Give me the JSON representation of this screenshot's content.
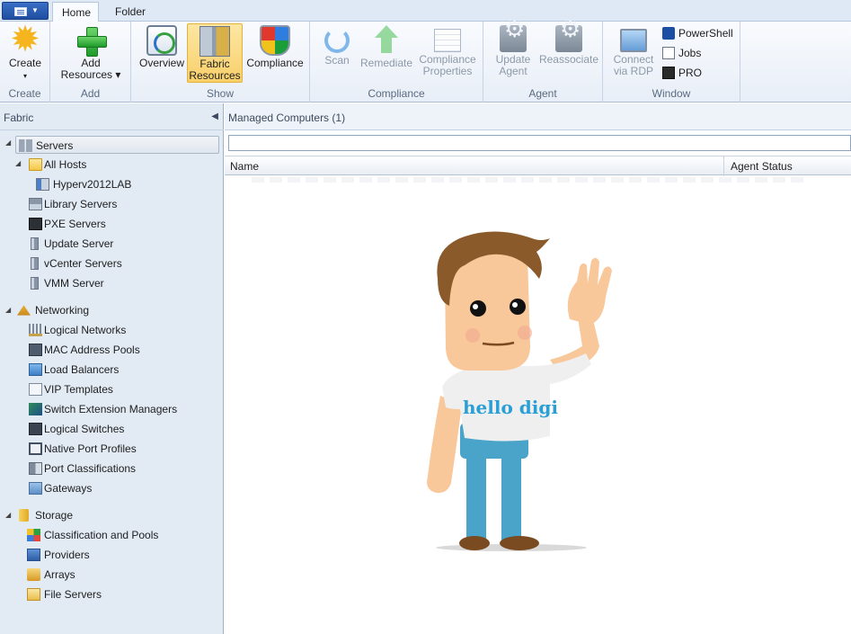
{
  "tabs": {
    "home": "Home",
    "folder": "Folder"
  },
  "ribbon": {
    "groups": [
      {
        "label": "Create"
      },
      {
        "label": "Add"
      },
      {
        "label": "Show"
      },
      {
        "label": "Compliance"
      },
      {
        "label": "Agent"
      },
      {
        "label": "Window"
      }
    ],
    "buttons": {
      "create_line1": "Create",
      "create_line2": "▾",
      "add_line1": "Add",
      "add_line2": "Resources ▾",
      "overview": "Overview",
      "fabric_line1": "Fabric",
      "fabric_line2": "Resources",
      "compliance": "Compliance",
      "scan": "Scan",
      "remediate": "Remediate",
      "compprops_line1": "Compliance",
      "compprops_line2": "Properties",
      "update_line1": "Update",
      "update_line2": "Agent",
      "reassociate": "Reassociate",
      "rdp_line1": "Connect",
      "rdp_line2": "via RDP",
      "powershell": "PowerShell",
      "jobs": "Jobs",
      "pro": "PRO"
    }
  },
  "nav": {
    "header": "Fabric",
    "servers": "Servers",
    "all_hosts": "All Hosts",
    "host": "Hyperv2012LAB",
    "library_servers": "Library Servers",
    "pxe_servers": "PXE Servers",
    "update_server": "Update Server",
    "vcenter_servers": "vCenter Servers",
    "vmm_server": "VMM Server",
    "networking": "Networking",
    "logical_networks": "Logical Networks",
    "mac_pools": "MAC Address Pools",
    "load_balancers": "Load Balancers",
    "vip_templates": "VIP Templates",
    "switch_ext": "Switch Extension Managers",
    "logical_switches": "Logical Switches",
    "native_port": "Native Port Profiles",
    "port_class": "Port Classifications",
    "gateways": "Gateways",
    "storage": "Storage",
    "class_pools": "Classification and Pools",
    "providers": "Providers",
    "arrays": "Arrays",
    "file_servers": "File Servers"
  },
  "content": {
    "title": "Managed Computers (1)",
    "search_value": "",
    "columns": {
      "name": "Name",
      "agent_status": "Agent Status"
    }
  },
  "overlay": {
    "shirt_text": "hello digi"
  },
  "colors": {
    "accent": "#f8cf6a",
    "navbg": "#e2eaf4",
    "shirt_text": "#2a9fd6"
  }
}
